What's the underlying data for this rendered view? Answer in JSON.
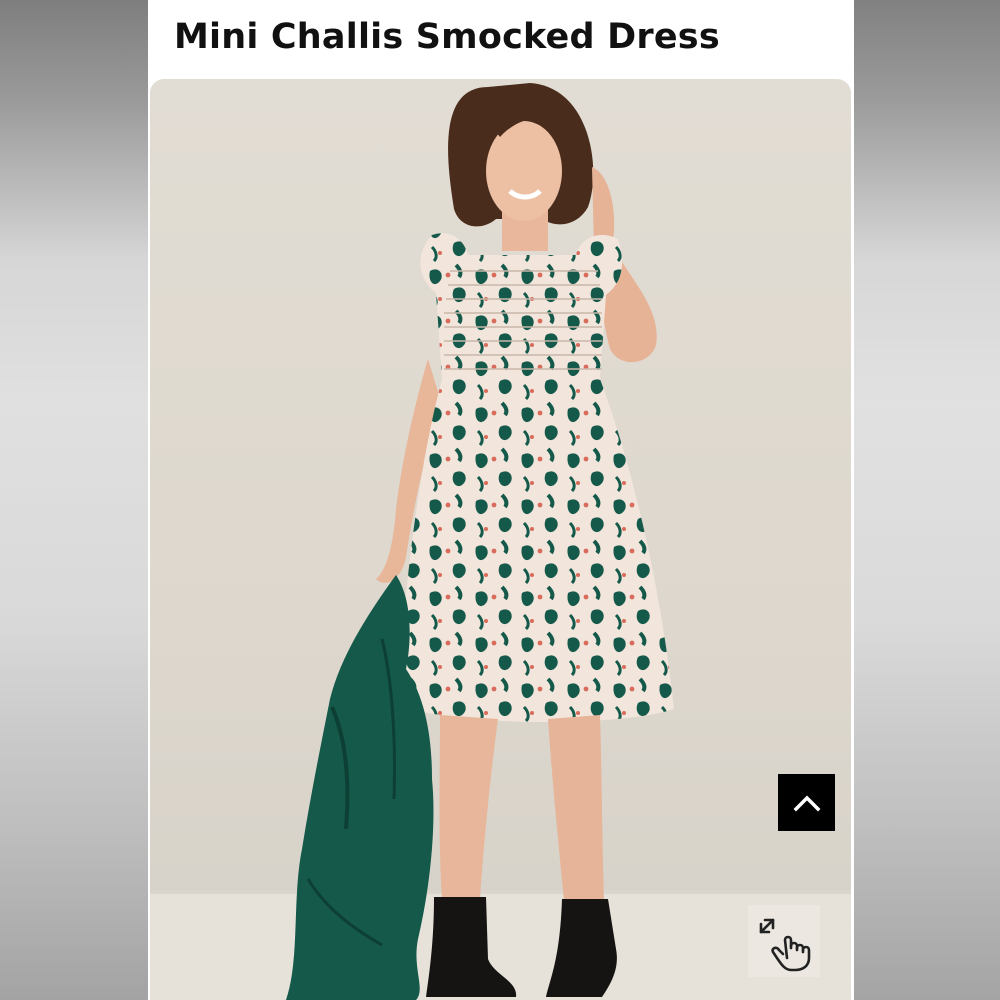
{
  "product": {
    "title": "Mini Challis Smocked Dress"
  },
  "icons": {
    "scroll_top": "chevron-up-icon",
    "zoom": "tap-to-zoom-icon"
  },
  "colors": {
    "accent_green": "#14594a",
    "button_black": "#000000"
  }
}
